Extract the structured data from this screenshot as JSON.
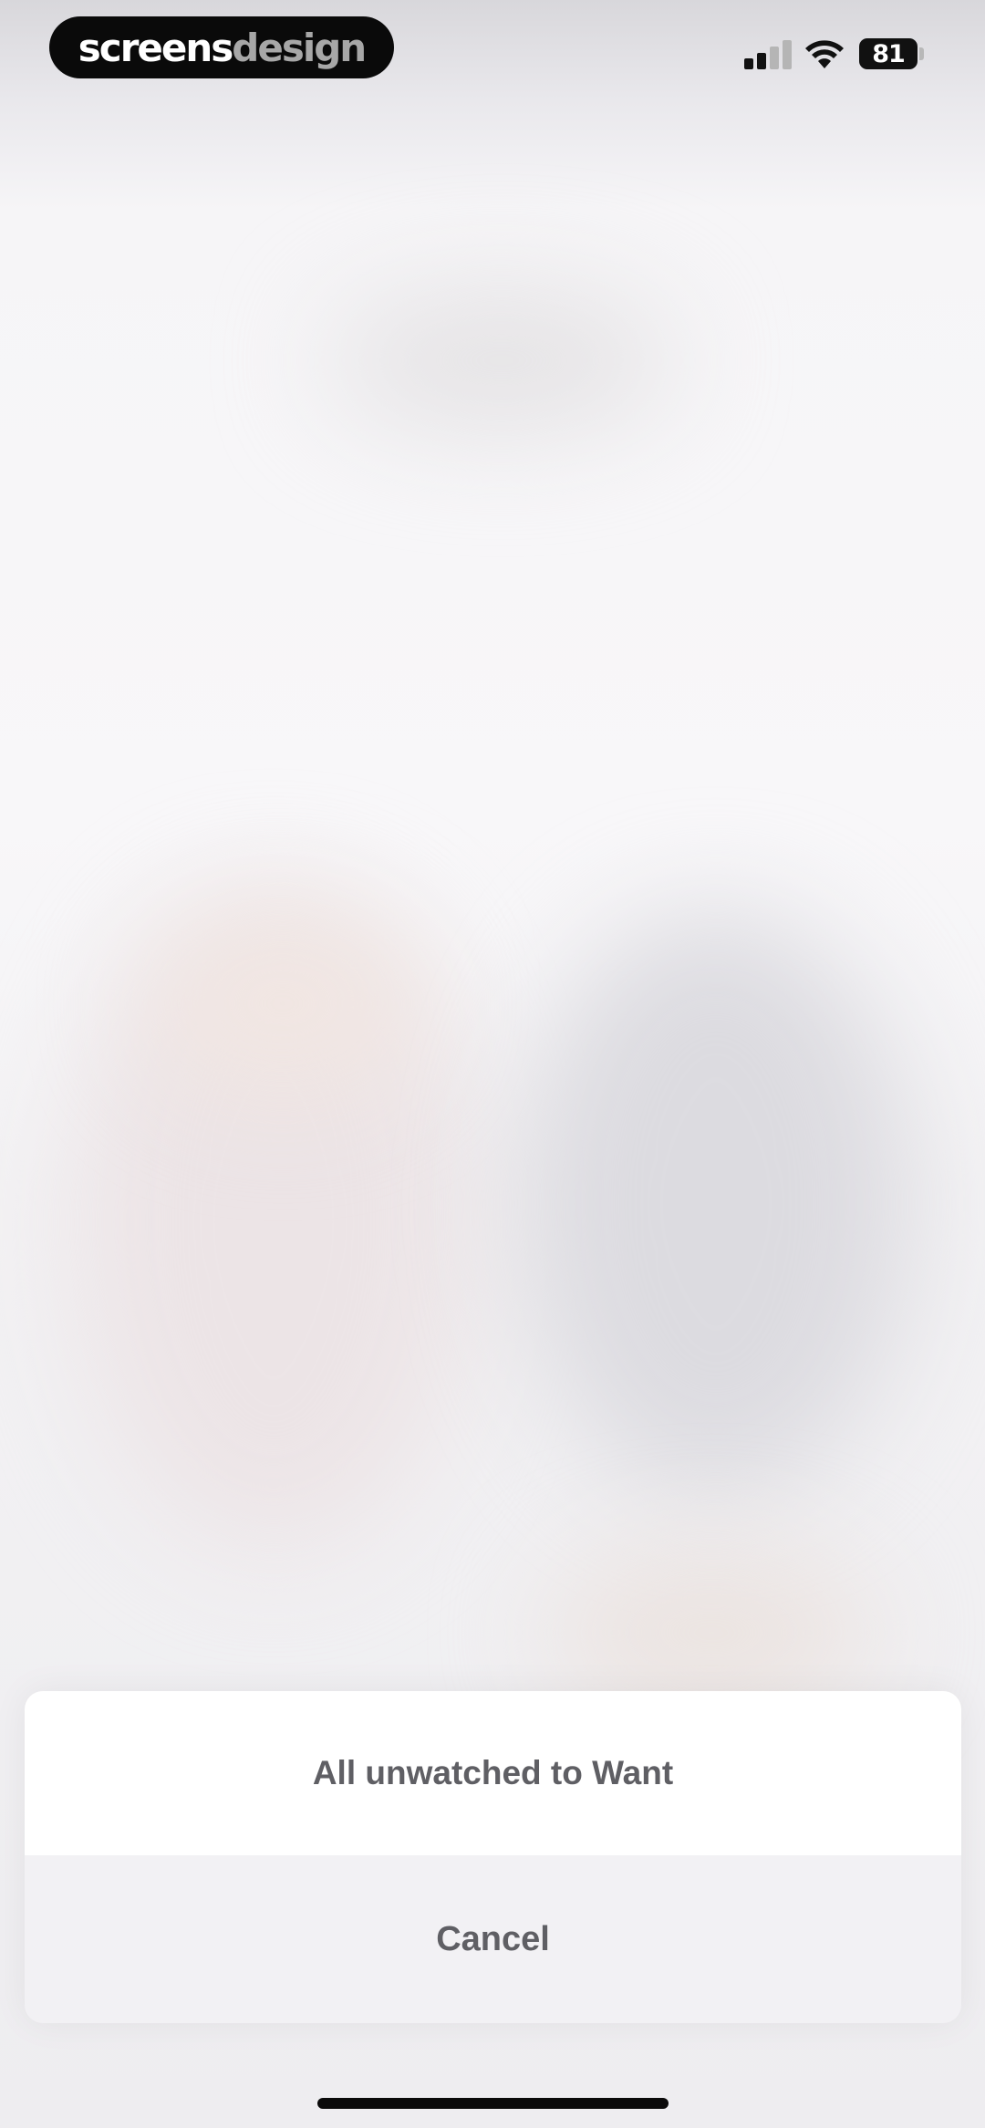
{
  "status_bar": {
    "brand_part1": "screens",
    "brand_part2": "design",
    "battery_level": "81",
    "signal_icon": "cellular-signal-icon",
    "wifi_icon": "wifi-icon",
    "battery_icon": "battery-icon"
  },
  "action_sheet": {
    "primary_action_label": "All unwatched to Want",
    "cancel_label": "Cancel"
  },
  "colors": {
    "sheet_background": "#ffffff",
    "cancel_background": "#f2f1f4",
    "action_text": "#5f5f64"
  }
}
